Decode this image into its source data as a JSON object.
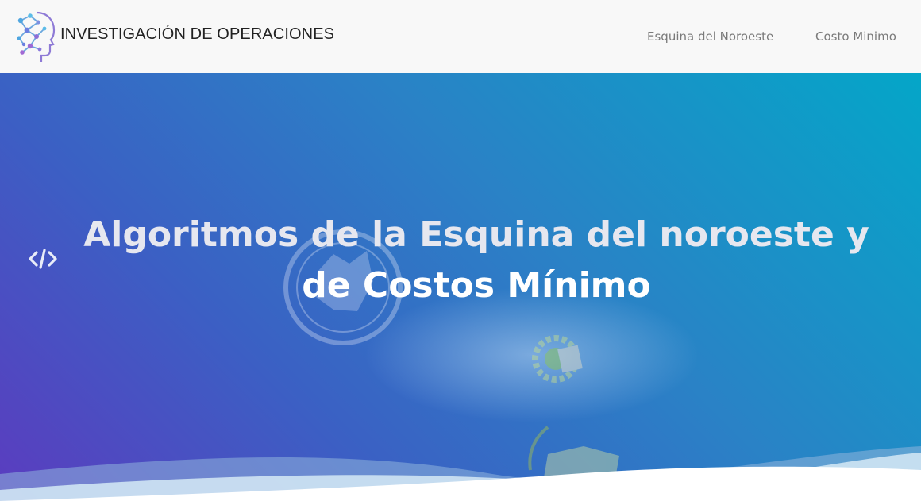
{
  "brand": {
    "name": "INVESTIGACIÓN DE OPERACIONES",
    "logo_icon": "ai-head-network-icon"
  },
  "nav": {
    "items": [
      {
        "label": "Esquina del Noroeste"
      },
      {
        "label": "Costo Minimo"
      }
    ]
  },
  "hero": {
    "title_line1": "Algoritmos de la Esquina del noroeste y",
    "title_line2": "de Costos Mínimo",
    "side_icon": "code-icon",
    "gradient_colors": [
      "#5b3cbf",
      "#2a82c6",
      "#04a6c8"
    ]
  }
}
